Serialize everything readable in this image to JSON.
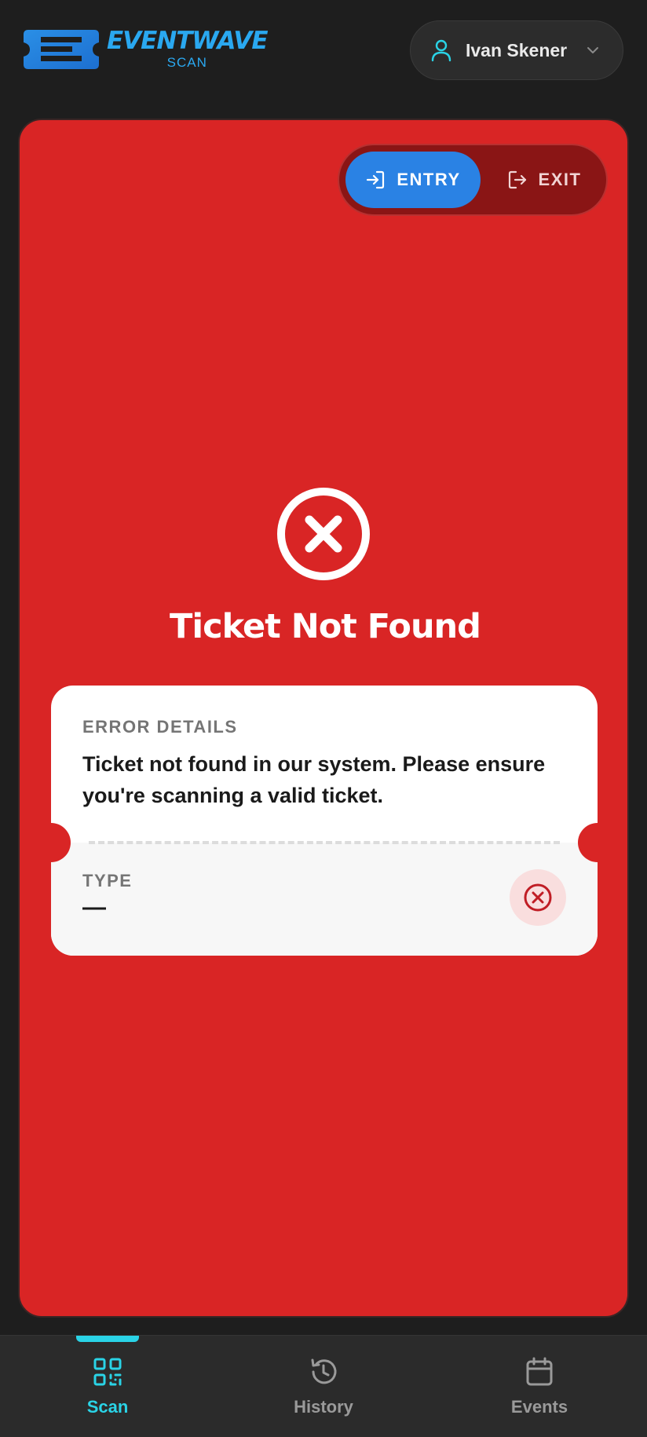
{
  "header": {
    "brand_name": "EVENTWAVE",
    "brand_sub": "SCAN",
    "user_name": "Ivan Skener"
  },
  "mode_toggle": {
    "entry_label": "ENTRY",
    "exit_label": "EXIT",
    "selected": "ENTRY"
  },
  "result": {
    "title": "Ticket Not Found",
    "error_label": "ERROR DETAILS",
    "error_message": "Ticket not found in our system. Please ensure you're scanning a valid ticket.",
    "type_label": "TYPE",
    "type_value": "—"
  },
  "nav": {
    "items": [
      {
        "label": "Scan",
        "icon": "qr-code-icon",
        "active": true
      },
      {
        "label": "History",
        "icon": "history-icon",
        "active": false
      },
      {
        "label": "Events",
        "icon": "calendar-icon",
        "active": false
      }
    ]
  },
  "colors": {
    "background": "#1e1e1e",
    "card_error": "#d92525",
    "toggle_track": "#8a1515",
    "entry_active": "#2a82e4",
    "accent": "#2ad3e6",
    "brand": "#2aa8f0"
  }
}
